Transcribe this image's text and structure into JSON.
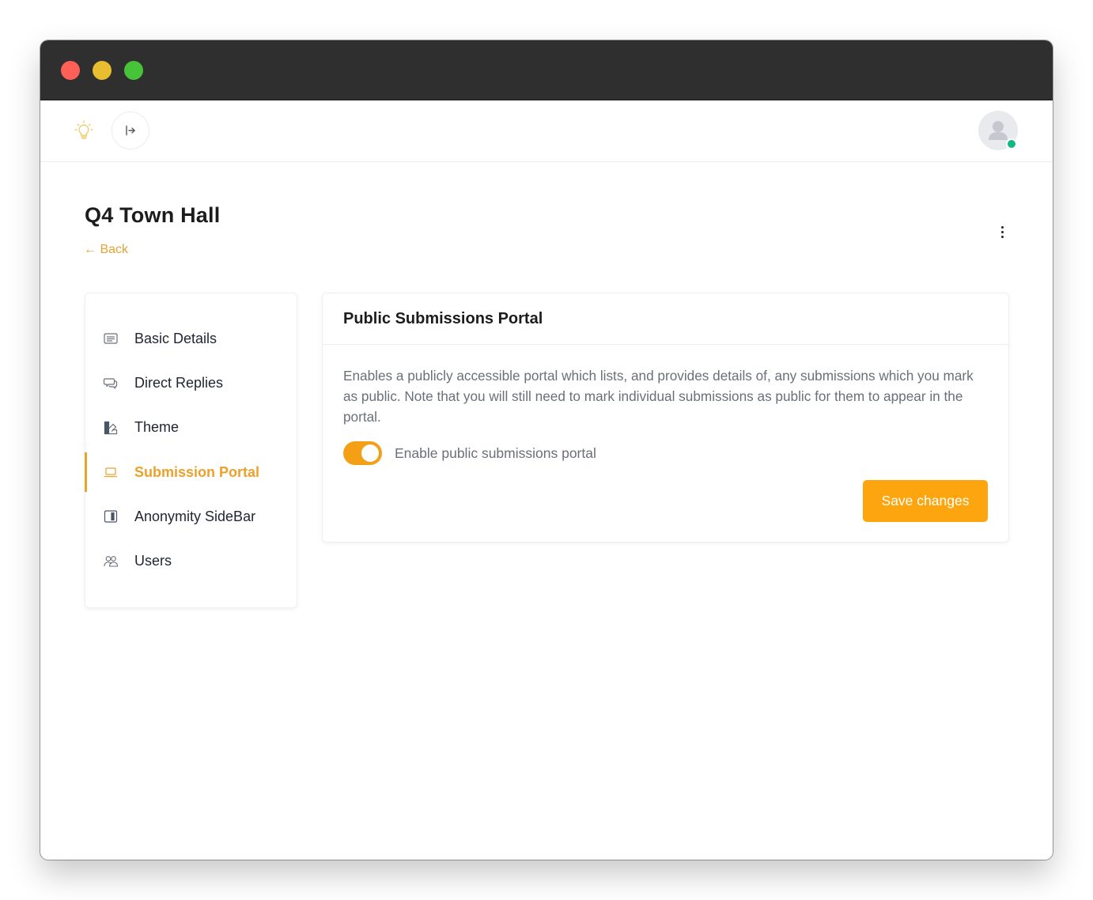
{
  "window": {
    "controls": [
      "close",
      "minimize",
      "maximize"
    ]
  },
  "topbar": {
    "logo_icon": "lightbulb-icon",
    "collapse_icon": "sidebar-expand-arrow-icon",
    "avatar_status": "online"
  },
  "page": {
    "title": "Q4 Town Hall",
    "back_label": "← Back",
    "menu_icon": "kebab-menu-icon"
  },
  "sidenav": {
    "items": [
      {
        "label": "Basic Details",
        "icon": "document-lines-icon",
        "active": false
      },
      {
        "label": "Direct Replies",
        "icon": "chat-bubbles-icon",
        "active": false
      },
      {
        "label": "Theme",
        "icon": "color-swatch-icon",
        "active": false
      },
      {
        "label": "Submission Portal",
        "icon": "laptop-icon",
        "active": true
      },
      {
        "label": "Anonymity SideBar",
        "icon": "sidebar-panel-icon",
        "active": false
      },
      {
        "label": "Users",
        "icon": "users-icon",
        "active": false
      }
    ]
  },
  "card": {
    "title": "Public Submissions Portal",
    "description": "Enables a publicly accessible portal which lists, and provides details of, any submissions which you mark as public. Note that you will still need to mark individual submissions as public for them to appear in the portal.",
    "toggle_label": "Enable public submissions portal",
    "toggle_on": true,
    "save_label": "Save changes"
  },
  "colors": {
    "accent": "#fca50f",
    "active_nav": "#eda12a",
    "status_online": "#10b981",
    "titlebar": "#2f2f2f"
  }
}
